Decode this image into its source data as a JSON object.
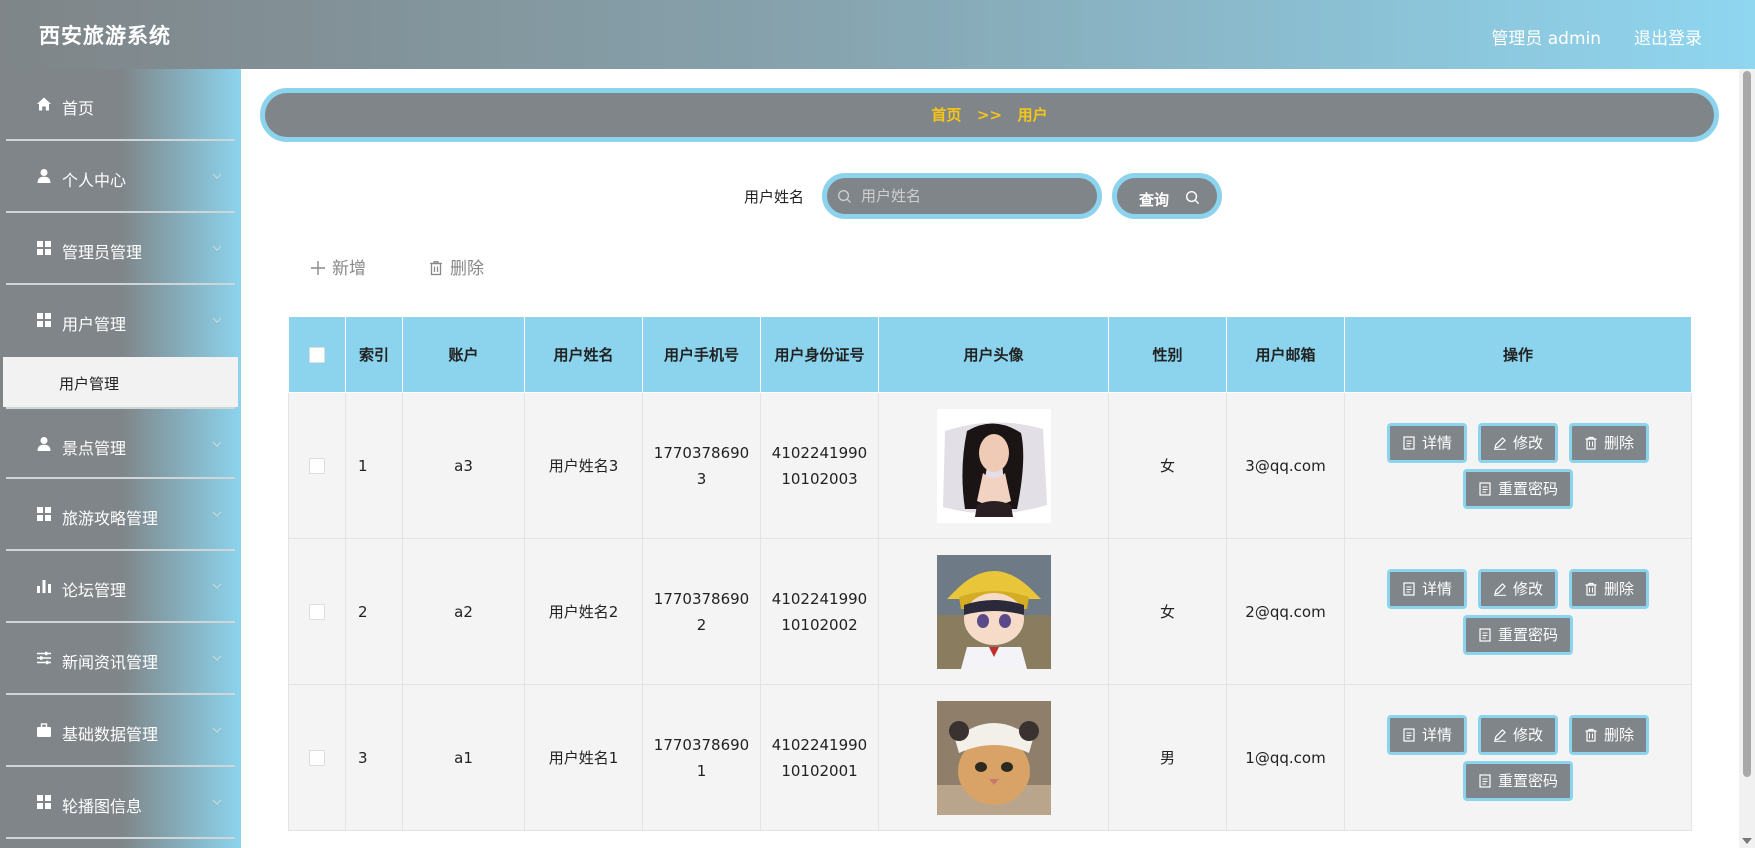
{
  "header": {
    "app_title": "西安旅游系统",
    "user_label": "管理员 admin",
    "logout_label": "退出登录"
  },
  "sidebar": {
    "items": [
      {
        "label": "首页",
        "icon": "home-icon"
      },
      {
        "label": "个人中心",
        "icon": "user-icon"
      },
      {
        "label": "管理员管理",
        "icon": "grid-icon"
      },
      {
        "label": "用户管理",
        "icon": "grid-icon"
      },
      {
        "label": "景点管理",
        "icon": "user-icon"
      },
      {
        "label": "旅游攻略管理",
        "icon": "grid-icon"
      },
      {
        "label": "论坛管理",
        "icon": "bar-chart-icon"
      },
      {
        "label": "新闻资讯管理",
        "icon": "sliders-icon"
      },
      {
        "label": "基础数据管理",
        "icon": "briefcase-icon"
      },
      {
        "label": "轮播图信息",
        "icon": "grid-icon"
      }
    ],
    "submenu_active": "用户管理"
  },
  "breadcrumb": {
    "home": "首页",
    "separator": ">>",
    "current": "用户"
  },
  "search": {
    "label": "用户姓名",
    "placeholder": "用户姓名",
    "value": "",
    "query_label": "查询"
  },
  "actions": {
    "add_label": "新增",
    "delete_label": "删除"
  },
  "table": {
    "headers": [
      "索引",
      "账户",
      "用户姓名",
      "用户手机号",
      "用户身份证号",
      "用户头像",
      "性别",
      "用户邮箱",
      "操作"
    ],
    "rows": [
      {
        "index": "1",
        "account": "a3",
        "name": "用户姓名3",
        "phone": "17703786903",
        "id_card": "410224199010102003",
        "gender": "女",
        "email": "3@qq.com"
      },
      {
        "index": "2",
        "account": "a2",
        "name": "用户姓名2",
        "phone": "17703786902",
        "id_card": "410224199010102002",
        "gender": "女",
        "email": "2@qq.com"
      },
      {
        "index": "3",
        "account": "a1",
        "name": "用户姓名1",
        "phone": "17703786901",
        "id_card": "410224199010102001",
        "gender": "男",
        "email": "1@qq.com"
      }
    ],
    "row_actions": {
      "detail": "详情",
      "edit": "修改",
      "delete": "删除",
      "reset_password": "重置密码"
    }
  },
  "colors": {
    "accent_blue": "#8cd4ee",
    "gray": "#7f8588",
    "breadcrumb_text": "#f5c518"
  }
}
